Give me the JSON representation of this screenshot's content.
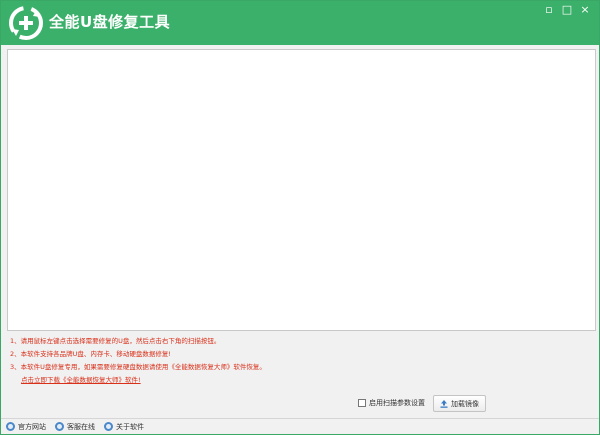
{
  "window": {
    "title": "全能U盘修复工具",
    "controls": {
      "minimize": "▫",
      "maximize": "□",
      "close": "×"
    }
  },
  "icons": {
    "logo": "circular-arrows-plus-icon",
    "load": "upload-icon",
    "site": "globe-icon",
    "support": "chat-icon",
    "about": "info-icon"
  },
  "colors": {
    "titlebar": "#3bb06a",
    "instruction_text": "#d9301a",
    "status_icon": "#4a88c9"
  },
  "instructions": {
    "line1": "1、请用鼠标左键点击选择需要修复的U盘，然后点击右下角的扫描按钮。",
    "line2": "2、本软件支持各品牌U盘、内存卡、移动硬盘数据修复!",
    "line3": "3、本软件U盘修复专用，如果需要修复硬盘数据请使用《全能数据恢复大师》软件恢复。",
    "download_link": "点击立即下载《全能数据恢复大师》软件!"
  },
  "controls": {
    "scan_settings_label": "启用扫描参数设置",
    "scan_settings_checked": false,
    "load_image_label": "加载镜像"
  },
  "statusbar": {
    "official_site": "官方网站",
    "online_support": "客服在线",
    "about": "关于软件"
  }
}
